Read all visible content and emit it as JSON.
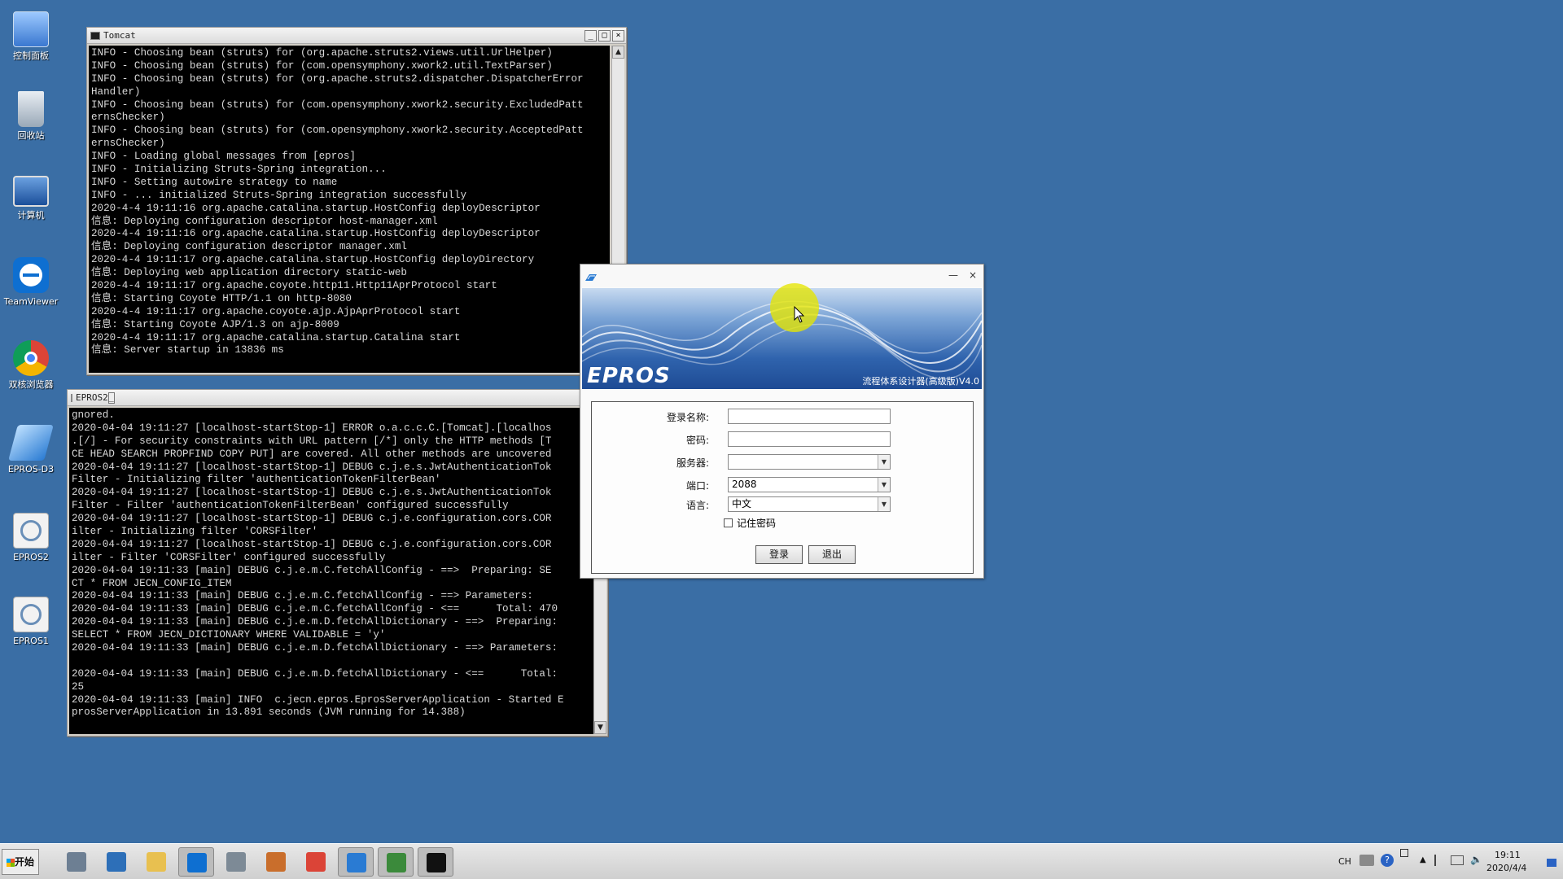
{
  "desktop": {
    "icons": [
      {
        "label": "控制面板",
        "icon": "control-panel-icon"
      },
      {
        "label": "回收站",
        "icon": "recycle-bin-icon"
      },
      {
        "label": "计算机",
        "icon": "computer-icon"
      },
      {
        "label": "TeamViewer",
        "icon": "teamviewer-icon"
      },
      {
        "label": "双核浏览器",
        "icon": "browser-icon"
      },
      {
        "label": "EPROS-D3",
        "icon": "epros-d3-icon"
      },
      {
        "label": "EPROS2",
        "icon": "epros2-icon"
      },
      {
        "label": "EPROS1",
        "icon": "epros1-icon"
      }
    ]
  },
  "tomcat_window": {
    "title": "Tomcat",
    "lines": [
      "INFO - Choosing bean (struts) for (org.apache.struts2.views.util.UrlHelper)",
      "INFO - Choosing bean (struts) for (com.opensymphony.xwork2.util.TextParser)",
      "INFO - Choosing bean (struts) for (org.apache.struts2.dispatcher.DispatcherError",
      "Handler)",
      "INFO - Choosing bean (struts) for (com.opensymphony.xwork2.security.ExcludedPatt",
      "ernsChecker)",
      "INFO - Choosing bean (struts) for (com.opensymphony.xwork2.security.AcceptedPatt",
      "ernsChecker)",
      "INFO - Loading global messages from [epros]",
      "INFO - Initializing Struts-Spring integration...",
      "INFO - Setting autowire strategy to name",
      "INFO - ... initialized Struts-Spring integration successfully",
      "2020-4-4 19:11:16 org.apache.catalina.startup.HostConfig deployDescriptor",
      "信息: Deploying configuration descriptor host-manager.xml",
      "2020-4-4 19:11:16 org.apache.catalina.startup.HostConfig deployDescriptor",
      "信息: Deploying configuration descriptor manager.xml",
      "2020-4-4 19:11:17 org.apache.catalina.startup.HostConfig deployDirectory",
      "信息: Deploying web application directory static-web",
      "2020-4-4 19:11:17 org.apache.coyote.http11.Http11AprProtocol start",
      "信息: Starting Coyote HTTP/1.1 on http-8080",
      "2020-4-4 19:11:17 org.apache.coyote.ajp.AjpAprProtocol start",
      "信息: Starting Coyote AJP/1.3 on ajp-8009",
      "2020-4-4 19:11:17 org.apache.catalina.startup.Catalina start",
      "信息: Server startup in 13836 ms"
    ]
  },
  "epros2_window": {
    "title": "EPROS2",
    "lines": [
      "gnored.",
      "2020-04-04 19:11:27 [localhost-startStop-1] ERROR o.a.c.c.C.[Tomcat].[localhos",
      ".[/] - For security constraints with URL pattern [/*] only the HTTP methods [T",
      "CE HEAD SEARCH PROPFIND COPY PUT] are covered. All other methods are uncovered",
      "2020-04-04 19:11:27 [localhost-startStop-1] DEBUG c.j.e.s.JwtAuthenticationTok",
      "Filter - Initializing filter 'authenticationTokenFilterBean'",
      "2020-04-04 19:11:27 [localhost-startStop-1] DEBUG c.j.e.s.JwtAuthenticationTok",
      "Filter - Filter 'authenticationTokenFilterBean' configured successfully",
      "2020-04-04 19:11:27 [localhost-startStop-1] DEBUG c.j.e.configuration.cors.COR",
      "ilter - Initializing filter 'CORSFilter'",
      "2020-04-04 19:11:27 [localhost-startStop-1] DEBUG c.j.e.configuration.cors.COR",
      "ilter - Filter 'CORSFilter' configured successfully",
      "2020-04-04 19:11:33 [main] DEBUG c.j.e.m.C.fetchAllConfig - ==>  Preparing: SE",
      "CT * FROM JECN_CONFIG_ITEM",
      "2020-04-04 19:11:33 [main] DEBUG c.j.e.m.C.fetchAllConfig - ==> Parameters:",
      "2020-04-04 19:11:33 [main] DEBUG c.j.e.m.C.fetchAllConfig - <==      Total: 470",
      "2020-04-04 19:11:33 [main] DEBUG c.j.e.m.D.fetchAllDictionary - ==>  Preparing:",
      "SELECT * FROM JECN_DICTIONARY WHERE VALIDABLE = 'y'",
      "2020-04-04 19:11:33 [main] DEBUG c.j.e.m.D.fetchAllDictionary - ==> Parameters:",
      "",
      "2020-04-04 19:11:33 [main] DEBUG c.j.e.m.D.fetchAllDictionary - <==      Total:",
      "25",
      "2020-04-04 19:11:33 [main] INFO  c.jecn.epros.EprosServerApplication - Started E",
      "prosServerApplication in 13.891 seconds (JVM running for 14.388)"
    ]
  },
  "login_dialog": {
    "logo": "EPROS",
    "subtitle": "流程体系设计器(高级版)V4.0",
    "username_label": "登录名称:",
    "username_value": "",
    "password_label": "密码:",
    "password_value": "",
    "server_label": "服务器:",
    "server_value": "",
    "port_label": "端口:",
    "port_value": "2088",
    "language_label": "语言:",
    "language_value": "中文",
    "remember_label": "记住密码",
    "remember_checked": false,
    "login_button": "登录",
    "exit_button": "退出"
  },
  "taskbar": {
    "start_label": "开始",
    "items": [
      {
        "icon": "server-manager-icon",
        "active": false
      },
      {
        "icon": "powershell-icon",
        "active": false
      },
      {
        "icon": "explorer-folder-icon",
        "active": false
      },
      {
        "icon": "teamviewer-icon",
        "active": true
      },
      {
        "icon": "tools-icon",
        "active": false
      },
      {
        "icon": "image-viewer-icon",
        "active": false
      },
      {
        "icon": "chrome-icon",
        "active": false
      },
      {
        "icon": "epros-icon",
        "active": true
      },
      {
        "icon": "tomcat-icon",
        "active": true
      },
      {
        "icon": "cmd-icon",
        "active": true
      }
    ],
    "tray": {
      "lang": "CH",
      "time": "19:11",
      "date": "2020/4/4"
    }
  },
  "colors": {
    "desktop": "#3a6ea5",
    "console_bg": "#000000",
    "console_fg": "#d8d8d8",
    "banner_dark": "#1e4b94"
  }
}
